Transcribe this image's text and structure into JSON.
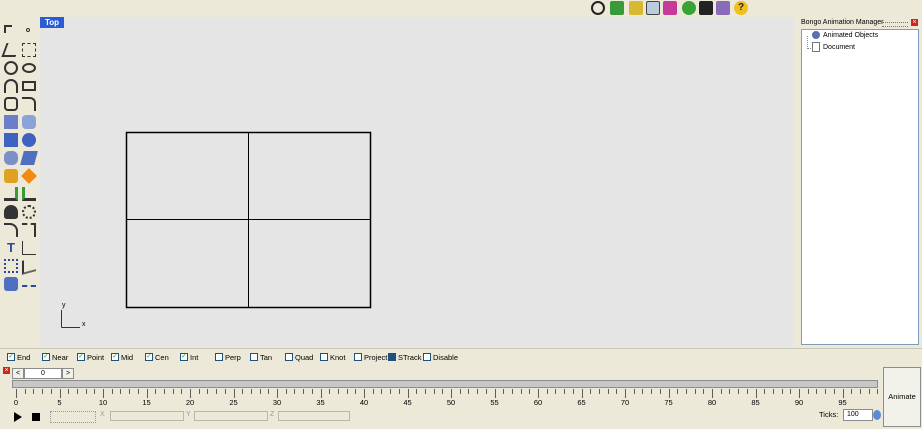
{
  "toolbar_icons": [
    "dimension-icon",
    "properties-icon",
    "layer-icon",
    "render-icon",
    "materials-icon",
    "animation-icon",
    "camera-icon",
    "options-icon",
    "help-icon"
  ],
  "viewport": {
    "label": "Top",
    "axis_x": "x",
    "axis_y": "y"
  },
  "panel": {
    "title": "Bongo Animation Manager",
    "close_label": "×",
    "items": [
      {
        "label": "Animated Objects",
        "icon": "objects-icon"
      },
      {
        "label": "Document",
        "icon": "document-icon"
      }
    ]
  },
  "snaps": [
    {
      "label": "End",
      "checked": true
    },
    {
      "label": "Near",
      "checked": true
    },
    {
      "label": "Point",
      "checked": true
    },
    {
      "label": "Mid",
      "checked": true
    },
    {
      "label": "Cen",
      "checked": true
    },
    {
      "label": "Int",
      "checked": true
    },
    {
      "label": "Perp",
      "checked": false
    },
    {
      "label": "Tan",
      "checked": false
    },
    {
      "label": "Quad",
      "checked": false
    },
    {
      "label": "Knot",
      "checked": false
    },
    {
      "label": "Project",
      "checked": false
    },
    {
      "label": "STrack",
      "checked": true
    },
    {
      "label": "Disable",
      "checked": false
    }
  ],
  "animation": {
    "close_label": "×",
    "prev_label": "<",
    "frame_value": "0",
    "next_label": ">",
    "tick_numbers": [
      "0",
      "5",
      "10",
      "15",
      "20",
      "25",
      "30",
      "35",
      "40",
      "45",
      "50",
      "55",
      "60",
      "65",
      "70",
      "75",
      "80",
      "85",
      "90",
      "95"
    ],
    "ticks_label": "Ticks:",
    "ticks_value": "100",
    "animate_label": "Animate",
    "x_label": "X",
    "y_label": "Y",
    "z_label": "Z",
    "play_icon": "play-icon",
    "stop_icon": "stop-icon"
  }
}
